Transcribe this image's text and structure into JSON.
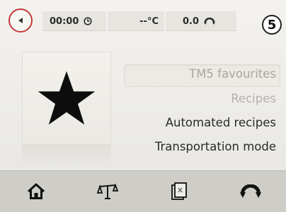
{
  "status_bar": {
    "timer": "00:00",
    "temperature": "--°C",
    "speed": "0.0"
  },
  "badge": "5",
  "menu": {
    "items": [
      {
        "label": "TM5 favourites",
        "color": "#a8a6a1"
      },
      {
        "label": "Recipes",
        "color": "#b4b2ad"
      },
      {
        "label": "Automated recipes",
        "color": "#2a2a2a"
      },
      {
        "label": "Transportation mode",
        "color": "#2a2a2a"
      }
    ]
  },
  "icons": {
    "back": "back-arrow-icon",
    "timer": "clock-icon",
    "speed": "reverse-rotation-icon",
    "favourite": "star-icon",
    "home": "home-icon",
    "scale": "scale-icon",
    "recipe_chip": "recipe-chip-icon",
    "reverse": "reverse-rotation-icon"
  },
  "colors": {
    "accent_ring": "#c23b3b",
    "text_dark": "#2a2a2a"
  }
}
